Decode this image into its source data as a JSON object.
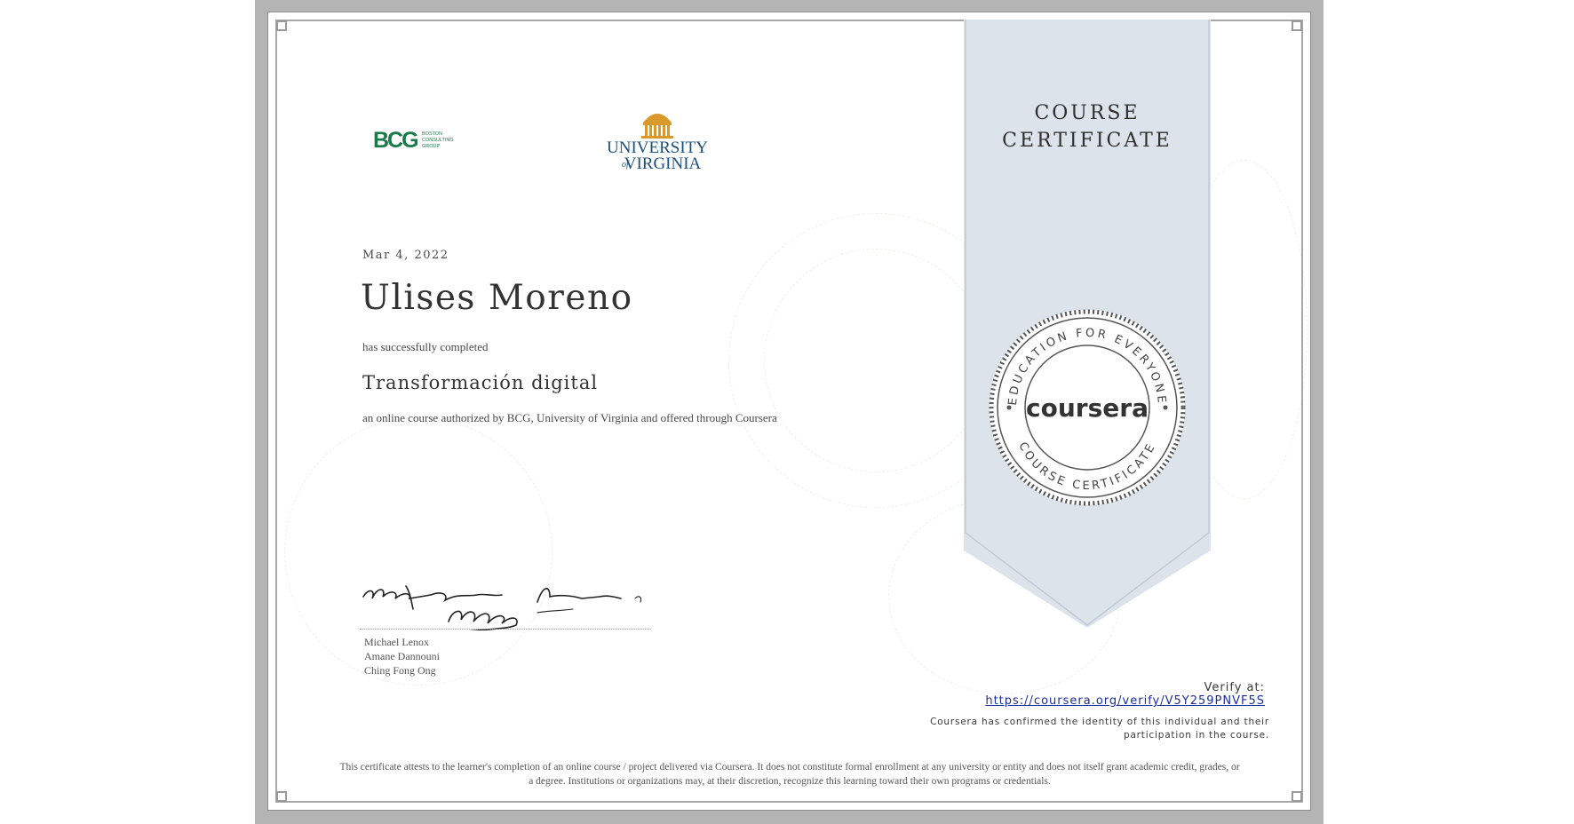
{
  "ribbon": {
    "title_line1": "COURSE",
    "title_line2": "CERTIFICATE"
  },
  "seal": {
    "top_arc_text": "EDUCATION FOR EVERYONE",
    "bottom_arc_text": "COURSE CERTIFICATE",
    "brand": "coursera"
  },
  "logos": {
    "bcg_mark": "BCG",
    "bcg_text": [
      "BOSTON",
      "CONSULTING",
      "GROUP"
    ],
    "uva_line1": "UNIVERSITY",
    "uva_of": "of",
    "uva_line2": "VIRGINIA"
  },
  "certificate": {
    "date": "Mar 4, 2022",
    "recipient": "Ulises Moreno",
    "completed_text": "has successfully completed",
    "course_title": "Transformación digital",
    "authorized_text": "an online course authorized by BCG, University of Virginia and offered through Coursera"
  },
  "signers": [
    "Michael Lenox",
    "Amane Dannouni",
    "Ching Fong Ong"
  ],
  "verify": {
    "label": "Verify at:",
    "url": "https://coursera.org/verify/V5Y259PNVF5S",
    "identity_line1": "Coursera has confirmed the identity of this individual and their",
    "identity_line2": "participation in the course."
  },
  "disclaimer": {
    "line1": "This certificate attests to the learner's completion of an online course / project delivered via Coursera. It does not constitute formal enrollment at any university or entity and does not itself grant academic credit, grades, or",
    "line2": "a degree. Institutions or organizations may, at their discretion, recognize this learning toward their own programs or credentials."
  },
  "colors": {
    "frame": "#b4b4b4",
    "ribbon": "#dde3ea",
    "bcg_green": "#1b7a4a",
    "uva_blue": "#1d4f7c",
    "uva_gold": "#d99a2b",
    "link": "#1a2e9e"
  }
}
